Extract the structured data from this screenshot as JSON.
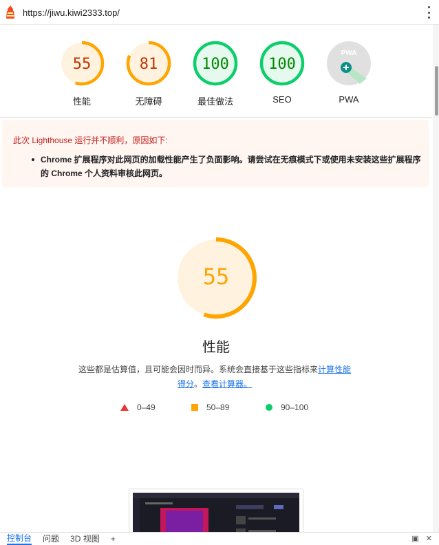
{
  "url": "https://jiwu.kiwi2333.top/",
  "icons": {
    "logo": "lighthouse-icon",
    "menu": "kebab-menu-icon",
    "pwa": "pwa-icon",
    "add": "plus-icon",
    "dock": "dock-icon",
    "close": "close-icon"
  },
  "colors": {
    "average": "#ffa400",
    "pass": "#0cce6b",
    "fail": "#e53935",
    "link": "#1a73e8"
  },
  "scores": [
    {
      "value": "55",
      "label": "性能",
      "level": 0.55
    },
    {
      "value": "81",
      "label": "无障碍",
      "level": 0.81
    },
    {
      "value": "100",
      "label": "最佳做法",
      "level": 1.0
    },
    {
      "value": "100",
      "label": "SEO",
      "level": 1.0
    },
    {
      "value": "",
      "label": "PWA",
      "level": 0
    }
  ],
  "pwa_badge": "PWA",
  "warning": {
    "title": "此次 Lighthouse 运行并不顺利，原因如下:",
    "item": "Chrome 扩展程序对此网页的加载性能产生了负面影响。请尝试在无痕模式下或使用未安装这些扩展程序的 Chrome 个人资料审核此网页。"
  },
  "performance": {
    "value": "55",
    "level": 0.55,
    "title": "性能",
    "desc_text": "这些都是估算值，且可能会因时而异。系统会直接基于这些指标来",
    "desc_link1": "计算性能得分",
    "desc_sep": "。",
    "desc_link2": "查看计算器。"
  },
  "legend": [
    {
      "range": "0–49"
    },
    {
      "range": "50–89"
    },
    {
      "range": "90–100"
    }
  ],
  "devtools_tabs": [
    "控制台",
    "问题",
    "3D 视图"
  ],
  "devtools_add": "+"
}
